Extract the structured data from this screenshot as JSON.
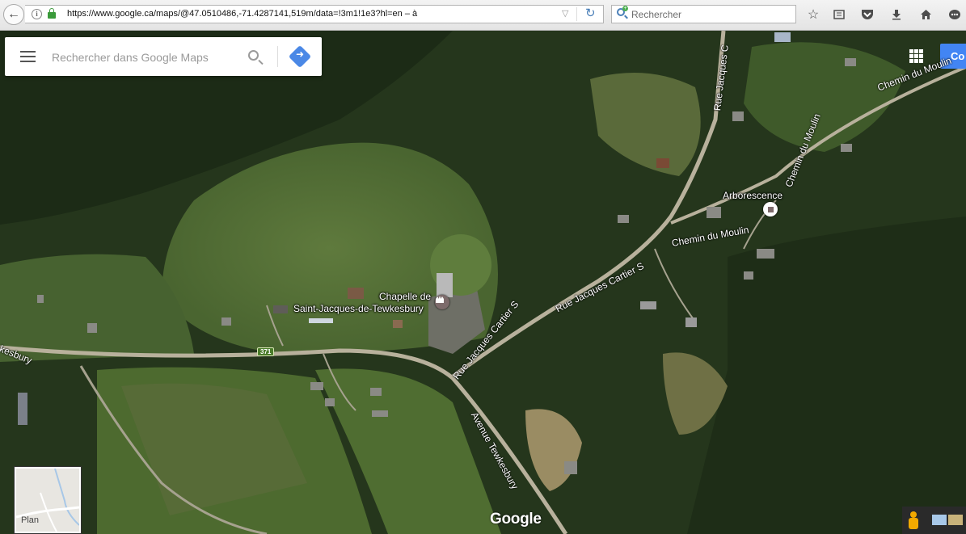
{
  "browser": {
    "url": "https://www.google.ca/maps/@47.0510486,-71.4287141,519m/data=!3m1!1e3?hl=en – à",
    "search_placeholder": "Rechercher",
    "icons": [
      "back-icon",
      "info-icon",
      "lock-icon",
      "dropdown-icon",
      "reload-icon",
      "search-icon",
      "star-icon",
      "reading-list-icon",
      "pocket-icon",
      "download-icon",
      "home-icon",
      "chat-icon"
    ]
  },
  "maps": {
    "search_placeholder": "Rechercher dans Google Maps",
    "connect_label": "Co",
    "minimap_label": "Plan",
    "logo": "Google",
    "route_number": "371",
    "places": {
      "chapel_line1": "Chapelle de",
      "chapel_line2": "Saint-Jacques-de-Tewkesbury",
      "arborescence": "Arborescence"
    },
    "roads": {
      "rue_jacques_cartier_s_1": "Rue Jacques Cartier S",
      "rue_jacques_cartier_s_2": "Rue Jacques Cartier S",
      "rue_jacques_c": "Rue Jacques C",
      "chemin_du_moulin_1": "Chemin du Moulin",
      "chemin_du_moulin_2": "Chemin du Moulin",
      "chemin_du_moulin_3": "Chemin du Moulin",
      "avenue_tewkesbury": "Avenue Tewkesbury",
      "kesbury": "kesbury"
    }
  }
}
